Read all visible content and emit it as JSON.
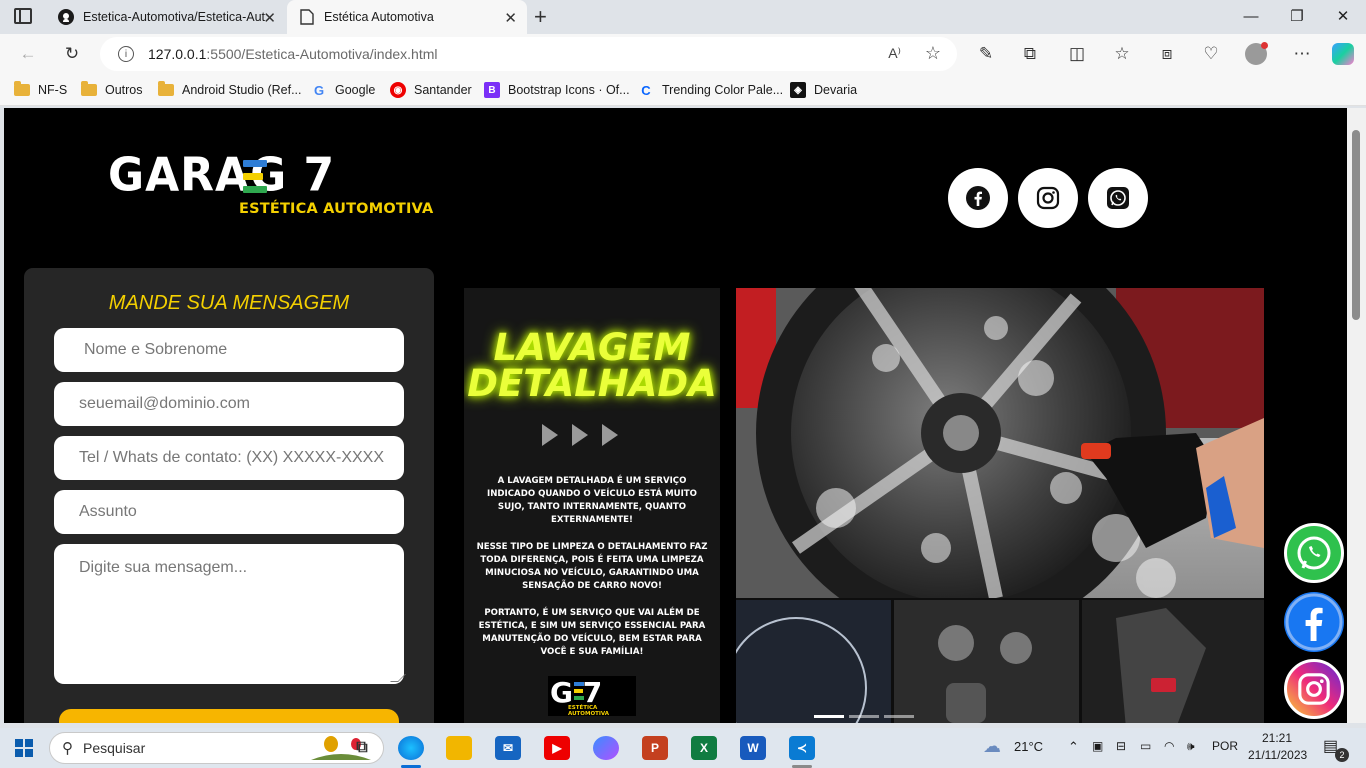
{
  "browser": {
    "tabs": [
      {
        "title": "Estetica-Automotiva/Estetica-Aut"
      },
      {
        "title": "Estética Automotiva"
      }
    ],
    "url_host": "127.0.0.1",
    "url_path": ":5500/Estetica-Automotiva/index.html",
    "bookmarks": [
      {
        "label": "NF-S"
      },
      {
        "label": "Outros"
      },
      {
        "label": "Android Studio (Ref..."
      },
      {
        "label": "Google"
      },
      {
        "label": "Santander"
      },
      {
        "label": "Bootstrap Icons · Of..."
      },
      {
        "label": "Trending Color Pale..."
      },
      {
        "label": "Devaria"
      }
    ]
  },
  "page": {
    "logo": {
      "main": "GARAG  7",
      "sub": "ESTÉTICA AUTOMOTIVA",
      "bar_colors": [
        "#2e7dd6",
        "#f4d000",
        "#2fa84f"
      ]
    },
    "form": {
      "title": "MANDE SUA MENSAGEM",
      "name_placeholder": "Nome e Sobrenome",
      "email_placeholder": "seuemail@dominio.com",
      "phone_placeholder": "Tel / Whats de contato: (XX) XXXXX-XXXX",
      "subject_placeholder": "Assunto",
      "message_placeholder": "Digite sua mensagem..."
    },
    "poster": {
      "title_line1": "LAVAGEM",
      "title_line2": "DETALHADA",
      "para1": "A LAVAGEM DETALHADA É UM SERVIÇO INDICADO QUANDO O VEÍCULO ESTÁ MUITO SUJO, TANTO INTERNAMENTE, QUANTO EXTERNAMENTE!",
      "para2": "NESSE TIPO DE LIMPEZA O DETALHAMENTO FAZ TODA DIFERENÇA, POIS É FEITA UMA LIMPEZA MINUCIOSA NO VEÍCULO, GARANTINDO UMA SENSAÇÃO DE CARRO NOVO!",
      "para3": "PORTANTO, É UM SERVIÇO QUE VAI ALÉM DE ESTÉTICA, E SIM UM SERVIÇO ESSENCIAL PARA MANUTENÇÃO DO VEÍCULO, BEM ESTAR PARA VOCÊ E SUA FAMÍLIA!",
      "logo_text": "G 7",
      "logo_sub": "ESTÉTICA AUTOMOTIVA"
    },
    "carousel": {
      "slide_count": 3,
      "active_index": 0
    }
  },
  "taskbar": {
    "search_text": "Pesquisar",
    "weather": "21°C",
    "language": "POR",
    "time": "21:21",
    "date": "21/11/2023",
    "notifications": "2"
  }
}
